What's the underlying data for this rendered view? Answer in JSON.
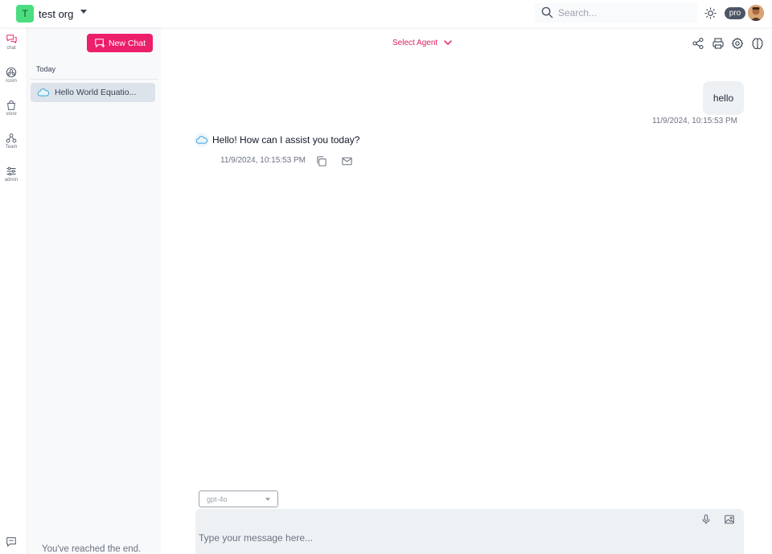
{
  "colors": {
    "accent": "#ec1f6b",
    "org_avatar": "#4ade80",
    "sidebar_bg": "#f8f9fb",
    "selected_chat_bg": "#dde3ea"
  },
  "header": {
    "org_initial": "T",
    "org_name": "test org",
    "search_placeholder": "Search...",
    "plan_badge": "pro"
  },
  "rail": {
    "items": [
      {
        "label": "chat",
        "icon": "chat-icon"
      },
      {
        "label": "room",
        "icon": "room-icon"
      },
      {
        "label": "store",
        "icon": "store-bag-icon"
      },
      {
        "label": "Team",
        "icon": "team-icon"
      },
      {
        "label": "admin",
        "icon": "admin-sliders-icon"
      }
    ]
  },
  "chat_list": {
    "new_chat_label": "New Chat",
    "section_today": "Today",
    "items": [
      {
        "title": "Hello World Equatio..."
      }
    ],
    "end_text": "You've reached the end."
  },
  "conversation": {
    "select_agent_label": "Select Agent",
    "messages": [
      {
        "role": "user",
        "text": "hello",
        "time": "11/9/2024, 10:15:53 PM"
      },
      {
        "role": "assistant",
        "text": "Hello! How can I assist you today?",
        "time": "11/9/2024, 10:15:53 PM"
      }
    ]
  },
  "composer": {
    "model": "gpt-4o",
    "placeholder": "Type your message here..."
  }
}
